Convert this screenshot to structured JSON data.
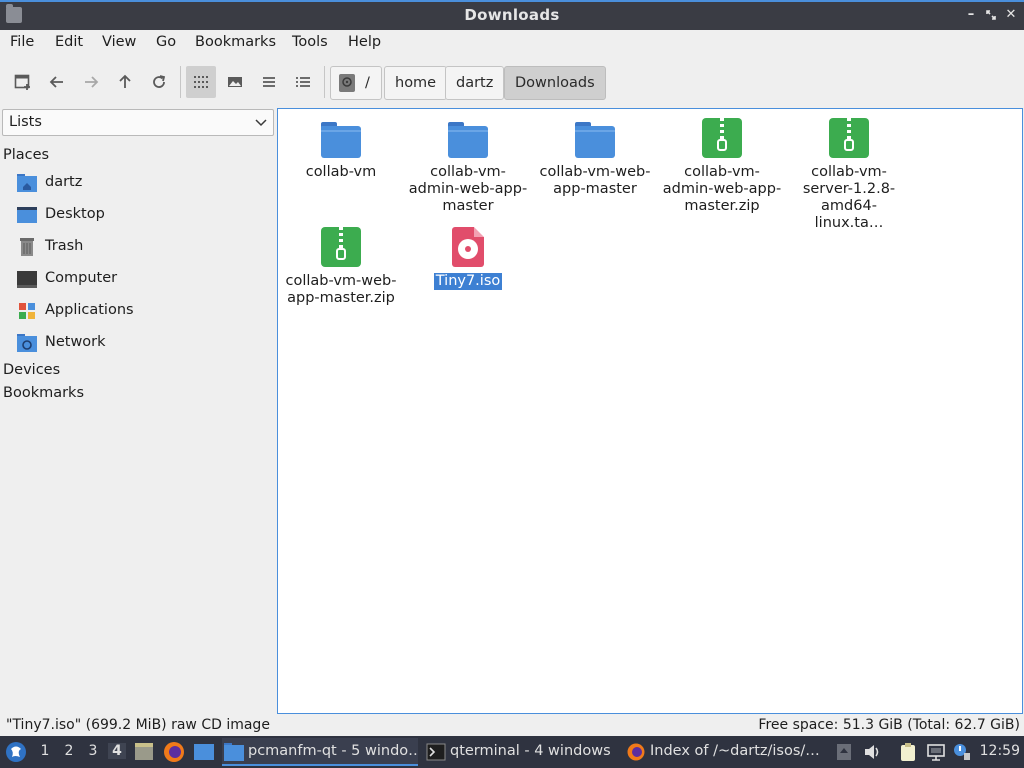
{
  "window": {
    "title": "Downloads"
  },
  "menubar": {
    "items": [
      "File",
      "Edit",
      "View",
      "Go",
      "Bookmarks",
      "Tools",
      "Help"
    ]
  },
  "breadcrumb": {
    "root": "/",
    "parts": [
      "home",
      "dartz",
      "Downloads"
    ]
  },
  "sidebar": {
    "combo_label": "Lists",
    "places_header": "Places",
    "places": [
      {
        "label": "dartz",
        "icon": "home-folder-icon"
      },
      {
        "label": "Desktop",
        "icon": "desktop-icon"
      },
      {
        "label": "Trash",
        "icon": "trash-icon"
      },
      {
        "label": "Computer",
        "icon": "computer-icon"
      },
      {
        "label": "Applications",
        "icon": "applications-icon"
      },
      {
        "label": "Network",
        "icon": "network-folder-icon"
      }
    ],
    "devices_header": "Devices",
    "bookmarks_header": "Bookmarks"
  },
  "files": [
    {
      "name": "collab-vm",
      "type": "folder"
    },
    {
      "name": "collab-vm-admin-web-app-master",
      "type": "folder"
    },
    {
      "name": "collab-vm-web-app-master",
      "type": "folder"
    },
    {
      "name": "collab-vm-admin-web-app-master.zip",
      "type": "zip"
    },
    {
      "name": "collab-vm-server-1.2.8-amd64-linux.ta…",
      "type": "zip"
    },
    {
      "name": "collab-vm-web-app-master.zip",
      "type": "zip"
    },
    {
      "name": "Tiny7.iso",
      "type": "iso",
      "selected": true
    }
  ],
  "statusbar": {
    "selection": "\"Tiny7.iso\" (699.2 MiB) raw CD image",
    "free_space": "Free space: 51.3 GiB (Total: 62.7 GiB)"
  },
  "taskbar": {
    "desktops": [
      "1",
      "2",
      "3",
      "4"
    ],
    "active_desktop": "4",
    "tasks": [
      {
        "label": "pcmanfm-qt - 5 windo…",
        "icon": "folder-icon"
      },
      {
        "label": "qterminal - 4 windows",
        "icon": "terminal-icon"
      },
      {
        "label": "Index of /~dartz/isos/…",
        "icon": "firefox-icon"
      }
    ],
    "clock": "12:59"
  },
  "colors": {
    "accent": "#4a8fdc",
    "folder": "#4a8fdc",
    "zip": "#3cac4f",
    "iso": "#e14d6b",
    "taskbar": "#2f3340",
    "titlebar": "#3a3c44"
  }
}
